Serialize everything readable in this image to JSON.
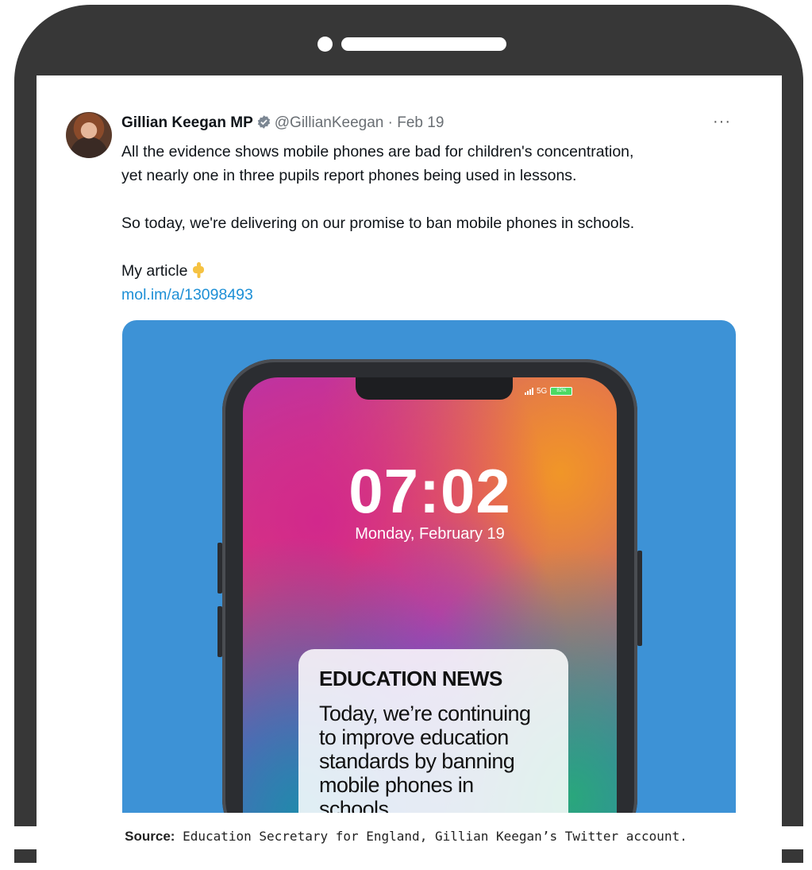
{
  "tweet": {
    "display_name": "Gillian Keegan MP",
    "handle": "@GillianKeegan",
    "separator": "·",
    "date": "Feb 19",
    "more_label": "···",
    "paragraph_1_line_1": "All the evidence shows mobile phones are bad for children's concentration,",
    "paragraph_1_line_2": "yet nearly one in three pupils report phones being used in lessons.",
    "paragraph_2": "So today, we're delivering on our promise to ban mobile phones in schools.",
    "article_label": "My article",
    "article_emoji": "pointing-down-icon",
    "link_text": "mol.im/a/13098493"
  },
  "media": {
    "background_color": "#3d92d6",
    "status_network": "5G",
    "battery_text": "82%",
    "clock": "07:02",
    "date": "Monday, February 19",
    "notification_title": "EDUCATION NEWS",
    "notification_lines": [
      "Today, we’re continuing",
      "to improve education",
      "standards by banning",
      "mobile phones in",
      "schools."
    ]
  },
  "caption": {
    "source_label": "Source:",
    "source_text": " Education Secretary for England, Gillian Keegan’s Twitter account."
  },
  "colors": {
    "frame": "#373737",
    "link": "#1d8fd6",
    "verified_badge": "#7c8793"
  }
}
